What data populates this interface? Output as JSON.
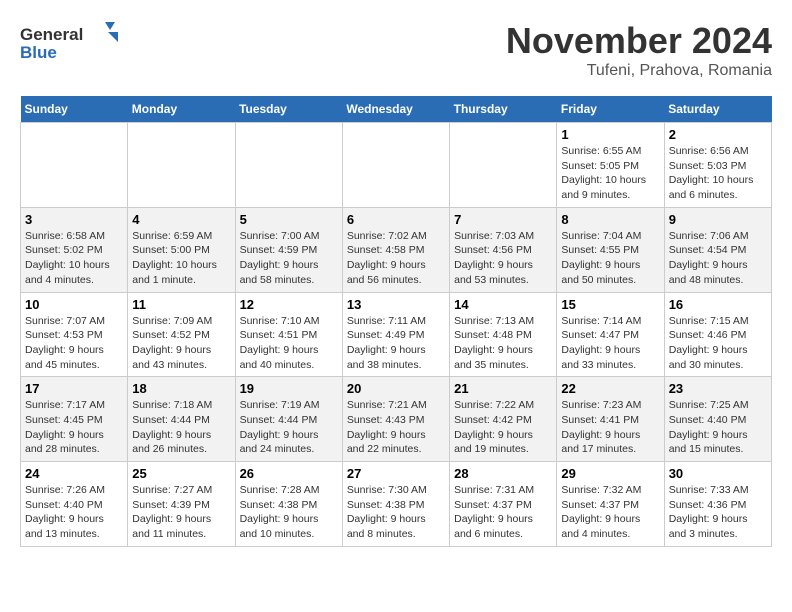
{
  "header": {
    "logo_general": "General",
    "logo_blue": "Blue",
    "month_title": "November 2024",
    "location": "Tufeni, Prahova, Romania"
  },
  "weekdays": [
    "Sunday",
    "Monday",
    "Tuesday",
    "Wednesday",
    "Thursday",
    "Friday",
    "Saturday"
  ],
  "weeks": [
    [
      {
        "day": "",
        "info": ""
      },
      {
        "day": "",
        "info": ""
      },
      {
        "day": "",
        "info": ""
      },
      {
        "day": "",
        "info": ""
      },
      {
        "day": "",
        "info": ""
      },
      {
        "day": "1",
        "info": "Sunrise: 6:55 AM\nSunset: 5:05 PM\nDaylight: 10 hours and 9 minutes."
      },
      {
        "day": "2",
        "info": "Sunrise: 6:56 AM\nSunset: 5:03 PM\nDaylight: 10 hours and 6 minutes."
      }
    ],
    [
      {
        "day": "3",
        "info": "Sunrise: 6:58 AM\nSunset: 5:02 PM\nDaylight: 10 hours and 4 minutes."
      },
      {
        "day": "4",
        "info": "Sunrise: 6:59 AM\nSunset: 5:00 PM\nDaylight: 10 hours and 1 minute."
      },
      {
        "day": "5",
        "info": "Sunrise: 7:00 AM\nSunset: 4:59 PM\nDaylight: 9 hours and 58 minutes."
      },
      {
        "day": "6",
        "info": "Sunrise: 7:02 AM\nSunset: 4:58 PM\nDaylight: 9 hours and 56 minutes."
      },
      {
        "day": "7",
        "info": "Sunrise: 7:03 AM\nSunset: 4:56 PM\nDaylight: 9 hours and 53 minutes."
      },
      {
        "day": "8",
        "info": "Sunrise: 7:04 AM\nSunset: 4:55 PM\nDaylight: 9 hours and 50 minutes."
      },
      {
        "day": "9",
        "info": "Sunrise: 7:06 AM\nSunset: 4:54 PM\nDaylight: 9 hours and 48 minutes."
      }
    ],
    [
      {
        "day": "10",
        "info": "Sunrise: 7:07 AM\nSunset: 4:53 PM\nDaylight: 9 hours and 45 minutes."
      },
      {
        "day": "11",
        "info": "Sunrise: 7:09 AM\nSunset: 4:52 PM\nDaylight: 9 hours and 43 minutes."
      },
      {
        "day": "12",
        "info": "Sunrise: 7:10 AM\nSunset: 4:51 PM\nDaylight: 9 hours and 40 minutes."
      },
      {
        "day": "13",
        "info": "Sunrise: 7:11 AM\nSunset: 4:49 PM\nDaylight: 9 hours and 38 minutes."
      },
      {
        "day": "14",
        "info": "Sunrise: 7:13 AM\nSunset: 4:48 PM\nDaylight: 9 hours and 35 minutes."
      },
      {
        "day": "15",
        "info": "Sunrise: 7:14 AM\nSunset: 4:47 PM\nDaylight: 9 hours and 33 minutes."
      },
      {
        "day": "16",
        "info": "Sunrise: 7:15 AM\nSunset: 4:46 PM\nDaylight: 9 hours and 30 minutes."
      }
    ],
    [
      {
        "day": "17",
        "info": "Sunrise: 7:17 AM\nSunset: 4:45 PM\nDaylight: 9 hours and 28 minutes."
      },
      {
        "day": "18",
        "info": "Sunrise: 7:18 AM\nSunset: 4:44 PM\nDaylight: 9 hours and 26 minutes."
      },
      {
        "day": "19",
        "info": "Sunrise: 7:19 AM\nSunset: 4:44 PM\nDaylight: 9 hours and 24 minutes."
      },
      {
        "day": "20",
        "info": "Sunrise: 7:21 AM\nSunset: 4:43 PM\nDaylight: 9 hours and 22 minutes."
      },
      {
        "day": "21",
        "info": "Sunrise: 7:22 AM\nSunset: 4:42 PM\nDaylight: 9 hours and 19 minutes."
      },
      {
        "day": "22",
        "info": "Sunrise: 7:23 AM\nSunset: 4:41 PM\nDaylight: 9 hours and 17 minutes."
      },
      {
        "day": "23",
        "info": "Sunrise: 7:25 AM\nSunset: 4:40 PM\nDaylight: 9 hours and 15 minutes."
      }
    ],
    [
      {
        "day": "24",
        "info": "Sunrise: 7:26 AM\nSunset: 4:40 PM\nDaylight: 9 hours and 13 minutes."
      },
      {
        "day": "25",
        "info": "Sunrise: 7:27 AM\nSunset: 4:39 PM\nDaylight: 9 hours and 11 minutes."
      },
      {
        "day": "26",
        "info": "Sunrise: 7:28 AM\nSunset: 4:38 PM\nDaylight: 9 hours and 10 minutes."
      },
      {
        "day": "27",
        "info": "Sunrise: 7:30 AM\nSunset: 4:38 PM\nDaylight: 9 hours and 8 minutes."
      },
      {
        "day": "28",
        "info": "Sunrise: 7:31 AM\nSunset: 4:37 PM\nDaylight: 9 hours and 6 minutes."
      },
      {
        "day": "29",
        "info": "Sunrise: 7:32 AM\nSunset: 4:37 PM\nDaylight: 9 hours and 4 minutes."
      },
      {
        "day": "30",
        "info": "Sunrise: 7:33 AM\nSunset: 4:36 PM\nDaylight: 9 hours and 3 minutes."
      }
    ]
  ]
}
